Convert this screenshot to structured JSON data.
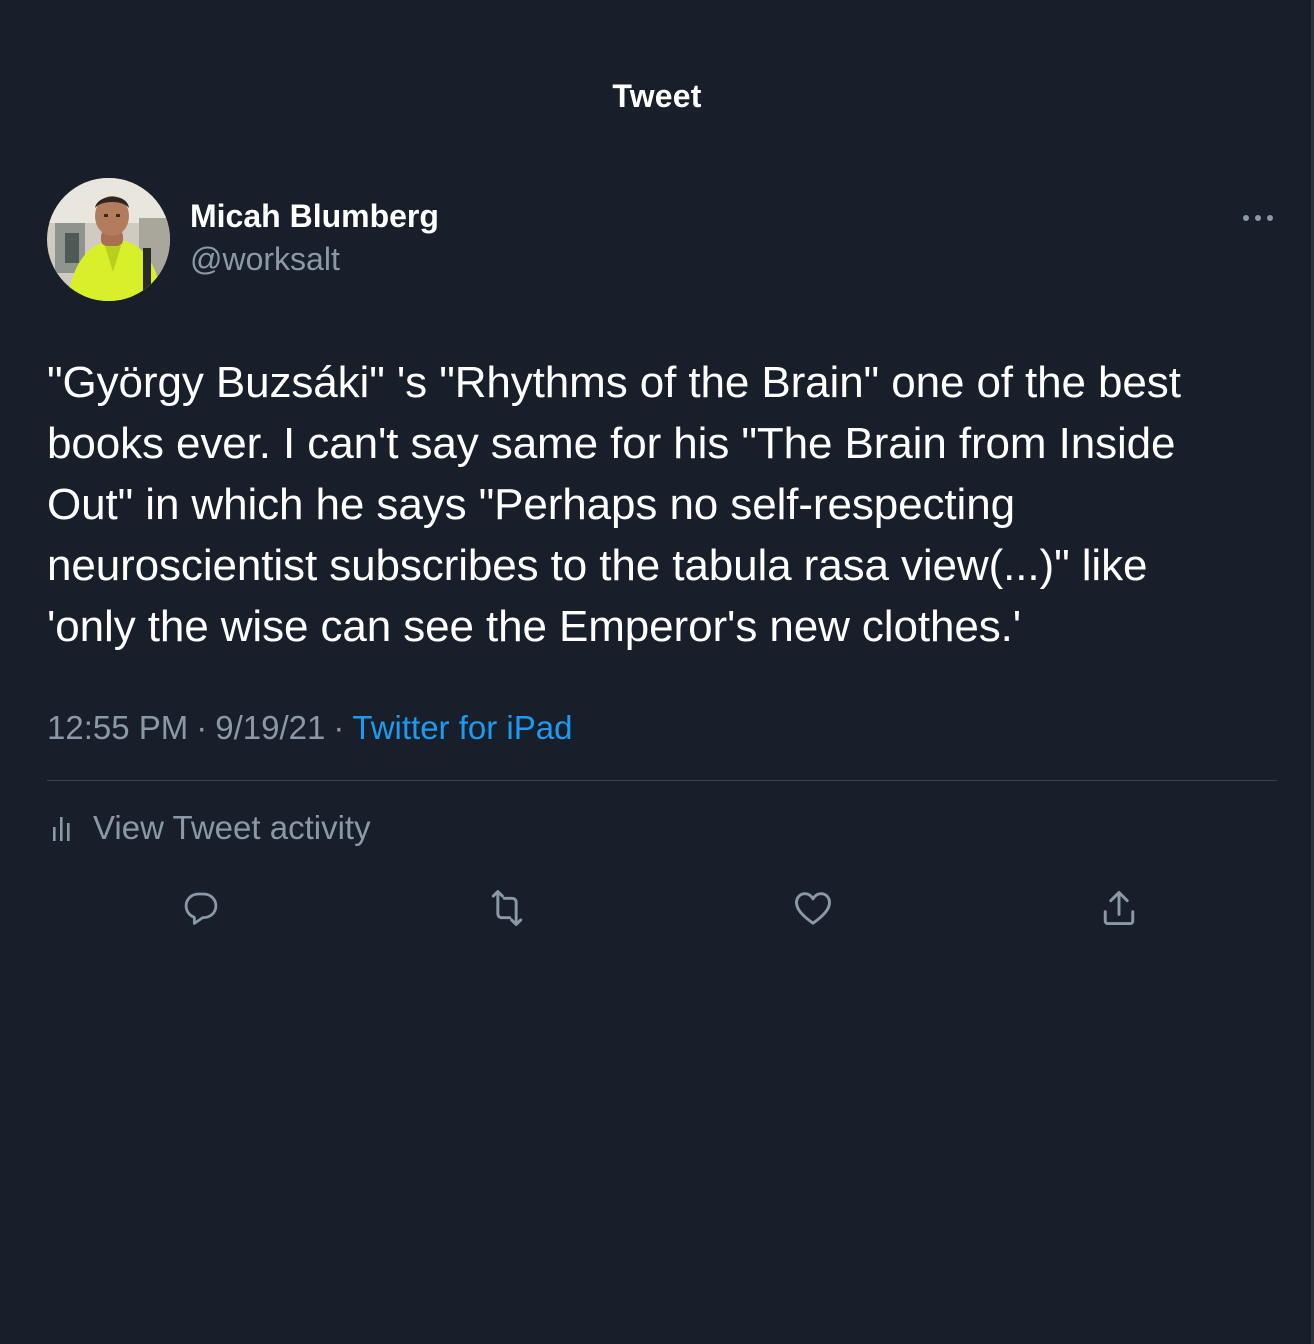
{
  "header": {
    "title": "Tweet"
  },
  "author": {
    "display_name": "Micah Blumberg",
    "handle": "@worksalt"
  },
  "tweet": {
    "text": "\"György Buzsáki\" 's \"Rhythms of the Brain\" one of the best\nbooks ever. I can't say same for his \"The Brain from Inside\nOut\" in which he says \"Perhaps no self-respecting\nneuroscientist subscribes to the tabula rasa view(...)\" like\n'only the wise can see the Emperor's new clothes.'",
    "time": "12:55 PM",
    "separator": "·",
    "date": "9/19/21",
    "source": "Twitter for iPad"
  },
  "activity": {
    "label": "View Tweet activity"
  },
  "actions": [
    {
      "name": "reply",
      "icon": "reply-icon"
    },
    {
      "name": "retweet",
      "icon": "retweet-icon"
    },
    {
      "name": "like",
      "icon": "heart-icon"
    },
    {
      "name": "share",
      "icon": "share-icon"
    }
  ],
  "colors": {
    "background": "#181f2a",
    "primary_text": "#ffffff",
    "secondary_text": "#8b98a5",
    "accent": "#1d9bf0",
    "divider": "#38444d"
  }
}
